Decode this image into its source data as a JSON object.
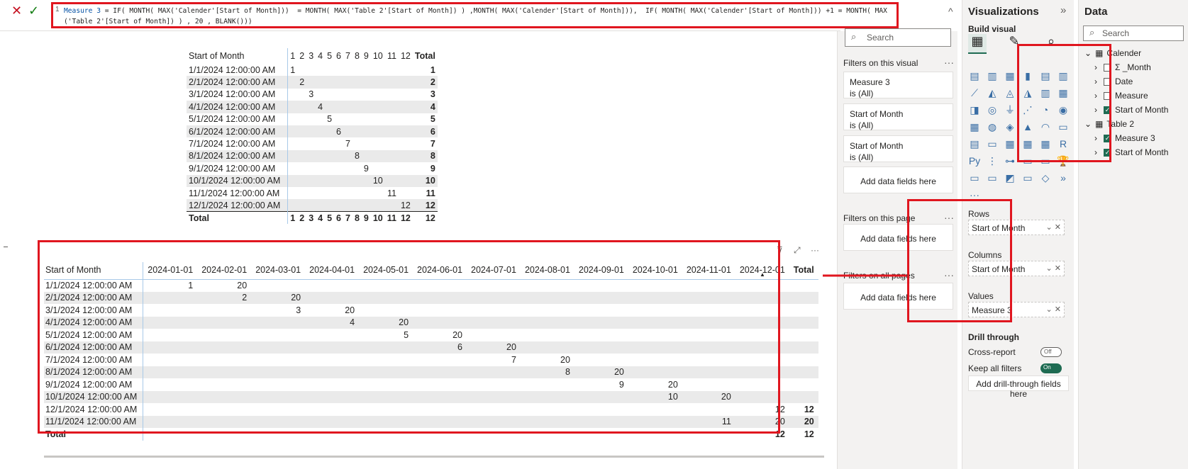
{
  "formula_bar": {
    "cancel_icon": "✕",
    "commit_icon": "✓",
    "line_number": "1",
    "measure_name": "Measure 3",
    "expression_line1": " = IF( MONTH( MAX('Calender'[Start of Month]))  = MONTH( MAX('Table 2'[Start of Month]) ) ,MONTH( MAX('Calender'[Start of Month])),  IF( MONTH( MAX('Calender'[Start of Month])) +1 = MONTH( MAX",
    "expression_line2": "('Table 2'[Start of Month]) ) , 20 , BLANK()))",
    "collapse_icon": "^"
  },
  "matrix1": {
    "row_header": "Start of Month",
    "columns": [
      "1",
      "2",
      "3",
      "4",
      "5",
      "6",
      "7",
      "8",
      "9",
      "10",
      "11",
      "12",
      "Total"
    ],
    "rows": [
      {
        "label": "1/1/2024 12:00:00 AM",
        "values": [
          "1",
          "",
          "",
          "",
          "",
          "",
          "",
          "",
          "",
          "",
          "",
          "",
          "1"
        ]
      },
      {
        "label": "2/1/2024 12:00:00 AM",
        "values": [
          "",
          "2",
          "",
          "",
          "",
          "",
          "",
          "",
          "",
          "",
          "",
          "",
          "2"
        ]
      },
      {
        "label": "3/1/2024 12:00:00 AM",
        "values": [
          "",
          "",
          "3",
          "",
          "",
          "",
          "",
          "",
          "",
          "",
          "",
          "",
          "3"
        ]
      },
      {
        "label": "4/1/2024 12:00:00 AM",
        "values": [
          "",
          "",
          "",
          "4",
          "",
          "",
          "",
          "",
          "",
          "",
          "",
          "",
          "4"
        ]
      },
      {
        "label": "5/1/2024 12:00:00 AM",
        "values": [
          "",
          "",
          "",
          "",
          "5",
          "",
          "",
          "",
          "",
          "",
          "",
          "",
          "5"
        ]
      },
      {
        "label": "6/1/2024 12:00:00 AM",
        "values": [
          "",
          "",
          "",
          "",
          "",
          "6",
          "",
          "",
          "",
          "",
          "",
          "",
          "6"
        ]
      },
      {
        "label": "7/1/2024 12:00:00 AM",
        "values": [
          "",
          "",
          "",
          "",
          "",
          "",
          "7",
          "",
          "",
          "",
          "",
          "",
          "7"
        ]
      },
      {
        "label": "8/1/2024 12:00:00 AM",
        "values": [
          "",
          "",
          "",
          "",
          "",
          "",
          "",
          "8",
          "",
          "",
          "",
          "",
          "8"
        ]
      },
      {
        "label": "9/1/2024 12:00:00 AM",
        "values": [
          "",
          "",
          "",
          "",
          "",
          "",
          "",
          "",
          "9",
          "",
          "",
          "",
          "9"
        ]
      },
      {
        "label": "10/1/2024 12:00:00 AM",
        "values": [
          "",
          "",
          "",
          "",
          "",
          "",
          "",
          "",
          "",
          "10",
          "",
          "",
          "10"
        ]
      },
      {
        "label": "11/1/2024 12:00:00 AM",
        "values": [
          "",
          "",
          "",
          "",
          "",
          "",
          "",
          "",
          "",
          "",
          "11",
          "",
          "11"
        ]
      },
      {
        "label": "12/1/2024 12:00:00 AM",
        "values": [
          "",
          "",
          "",
          "",
          "",
          "",
          "",
          "",
          "",
          "",
          "",
          "12",
          "12"
        ]
      }
    ],
    "total_row": {
      "label": "Total",
      "values": [
        "1",
        "2",
        "3",
        "4",
        "5",
        "6",
        "7",
        "8",
        "9",
        "10",
        "11",
        "12",
        "12"
      ]
    }
  },
  "matrix2": {
    "row_header": "Start of Month",
    "columns": [
      "2024-01-01",
      "2024-02-01",
      "2024-03-01",
      "2024-04-01",
      "2024-05-01",
      "2024-06-01",
      "2024-07-01",
      "2024-08-01",
      "2024-09-01",
      "2024-10-01",
      "2024-11-01",
      "2024-12-01",
      "Total"
    ],
    "rows": [
      {
        "label": "1/1/2024 12:00:00 AM",
        "values": [
          "1",
          "20",
          "",
          "",
          "",
          "",
          "",
          "",
          "",
          "",
          "",
          "",
          ""
        ]
      },
      {
        "label": "2/1/2024 12:00:00 AM",
        "values": [
          "",
          "2",
          "20",
          "",
          "",
          "",
          "",
          "",
          "",
          "",
          "",
          "",
          ""
        ]
      },
      {
        "label": "3/1/2024 12:00:00 AM",
        "values": [
          "",
          "",
          "3",
          "20",
          "",
          "",
          "",
          "",
          "",
          "",
          "",
          "",
          ""
        ]
      },
      {
        "label": "4/1/2024 12:00:00 AM",
        "values": [
          "",
          "",
          "",
          "4",
          "20",
          "",
          "",
          "",
          "",
          "",
          "",
          "",
          ""
        ]
      },
      {
        "label": "5/1/2024 12:00:00 AM",
        "values": [
          "",
          "",
          "",
          "",
          "5",
          "20",
          "",
          "",
          "",
          "",
          "",
          "",
          ""
        ]
      },
      {
        "label": "6/1/2024 12:00:00 AM",
        "values": [
          "",
          "",
          "",
          "",
          "",
          "6",
          "20",
          "",
          "",
          "",
          "",
          "",
          ""
        ]
      },
      {
        "label": "7/1/2024 12:00:00 AM",
        "values": [
          "",
          "",
          "",
          "",
          "",
          "",
          "7",
          "20",
          "",
          "",
          "",
          "",
          ""
        ]
      },
      {
        "label": "8/1/2024 12:00:00 AM",
        "values": [
          "",
          "",
          "",
          "",
          "",
          "",
          "",
          "8",
          "20",
          "",
          "",
          "",
          ""
        ]
      },
      {
        "label": "9/1/2024 12:00:00 AM",
        "values": [
          "",
          "",
          "",
          "",
          "",
          "",
          "",
          "",
          "9",
          "20",
          "",
          "",
          ""
        ]
      },
      {
        "label": "10/1/2024 12:00:00 AM",
        "values": [
          "",
          "",
          "",
          "",
          "",
          "",
          "",
          "",
          "",
          "10",
          "20",
          "",
          ""
        ]
      },
      {
        "label": "12/1/2024 12:00:00 AM",
        "values": [
          "",
          "",
          "",
          "",
          "",
          "",
          "",
          "",
          "",
          "",
          "",
          "12",
          "12"
        ]
      },
      {
        "label": "11/1/2024 12:00:00 AM",
        "values": [
          "",
          "",
          "",
          "",
          "",
          "",
          "",
          "",
          "",
          "",
          "11",
          "20",
          "20"
        ]
      }
    ],
    "total_row": {
      "label": "Total",
      "values": [
        "",
        "",
        "",
        "",
        "",
        "",
        "",
        "",
        "",
        "",
        "",
        "12",
        "12"
      ]
    },
    "sort_icon": "▲"
  },
  "visual_tools": {
    "filter_icon": "⊽",
    "focus_icon": "⤢",
    "more_icon": "···"
  },
  "filters": {
    "search_placeholder": "Search",
    "on_this_visual": "Filters on this visual",
    "cards": [
      {
        "name": "Measure 3",
        "state": "is (All)"
      },
      {
        "name": "Start of Month",
        "state": "is (All)"
      },
      {
        "name": "Start of Month",
        "state": "is (All)"
      }
    ],
    "add_fields": "Add data fields here",
    "on_this_page": "Filters on this page",
    "on_all_pages": "Filters on all pages",
    "more": "···"
  },
  "visualizations": {
    "title": "Visualizations",
    "expand_icon": "»",
    "build_visual": "Build visual",
    "grid_icons": [
      "▤",
      "▥",
      "▦",
      "▮",
      "▤",
      "▥",
      "⟋",
      "◭",
      "◬",
      "◮",
      "▥",
      "▦",
      "◨",
      "◎",
      "⏚",
      "⋰",
      "◔",
      "◉",
      "▦",
      "◍",
      "◈",
      "▲",
      "◠",
      "▭",
      "▤",
      "▭",
      "▦",
      "▦",
      "▦",
      "R",
      "Py",
      "⋮",
      "⊶",
      "▭",
      "▭",
      "🏆",
      "▭",
      "▭",
      "◩",
      "▭",
      "◇",
      "»",
      "···"
    ],
    "rows_label": "Rows",
    "rows_field": "Start of Month",
    "columns_label": "Columns",
    "columns_field": "Start of Month",
    "values_label": "Values",
    "values_field": "Measure 3",
    "well_controls": "⌄ ✕",
    "drill_through": "Drill through",
    "cross_report": "Cross-report",
    "cross_report_state": "Off",
    "keep_all_filters": "Keep all filters",
    "keep_all_filters_state": "On",
    "add_drill": "Add drill-through fields here"
  },
  "data": {
    "title": "Data",
    "search_placeholder": "Search",
    "tables": [
      {
        "name": "Calender",
        "fields": [
          {
            "name": "Σ _Month",
            "checked": false
          },
          {
            "name": "Date",
            "checked": false
          },
          {
            "name": "Measure",
            "checked": false
          },
          {
            "name": "Start of Month",
            "checked": true
          }
        ]
      },
      {
        "name": "Table 2",
        "fields": [
          {
            "name": "Measure 3",
            "checked": true
          },
          {
            "name": "Start of Month",
            "checked": true
          }
        ]
      }
    ]
  },
  "colors": {
    "highlight": "#e0161f",
    "accent": "#1e6b52"
  }
}
